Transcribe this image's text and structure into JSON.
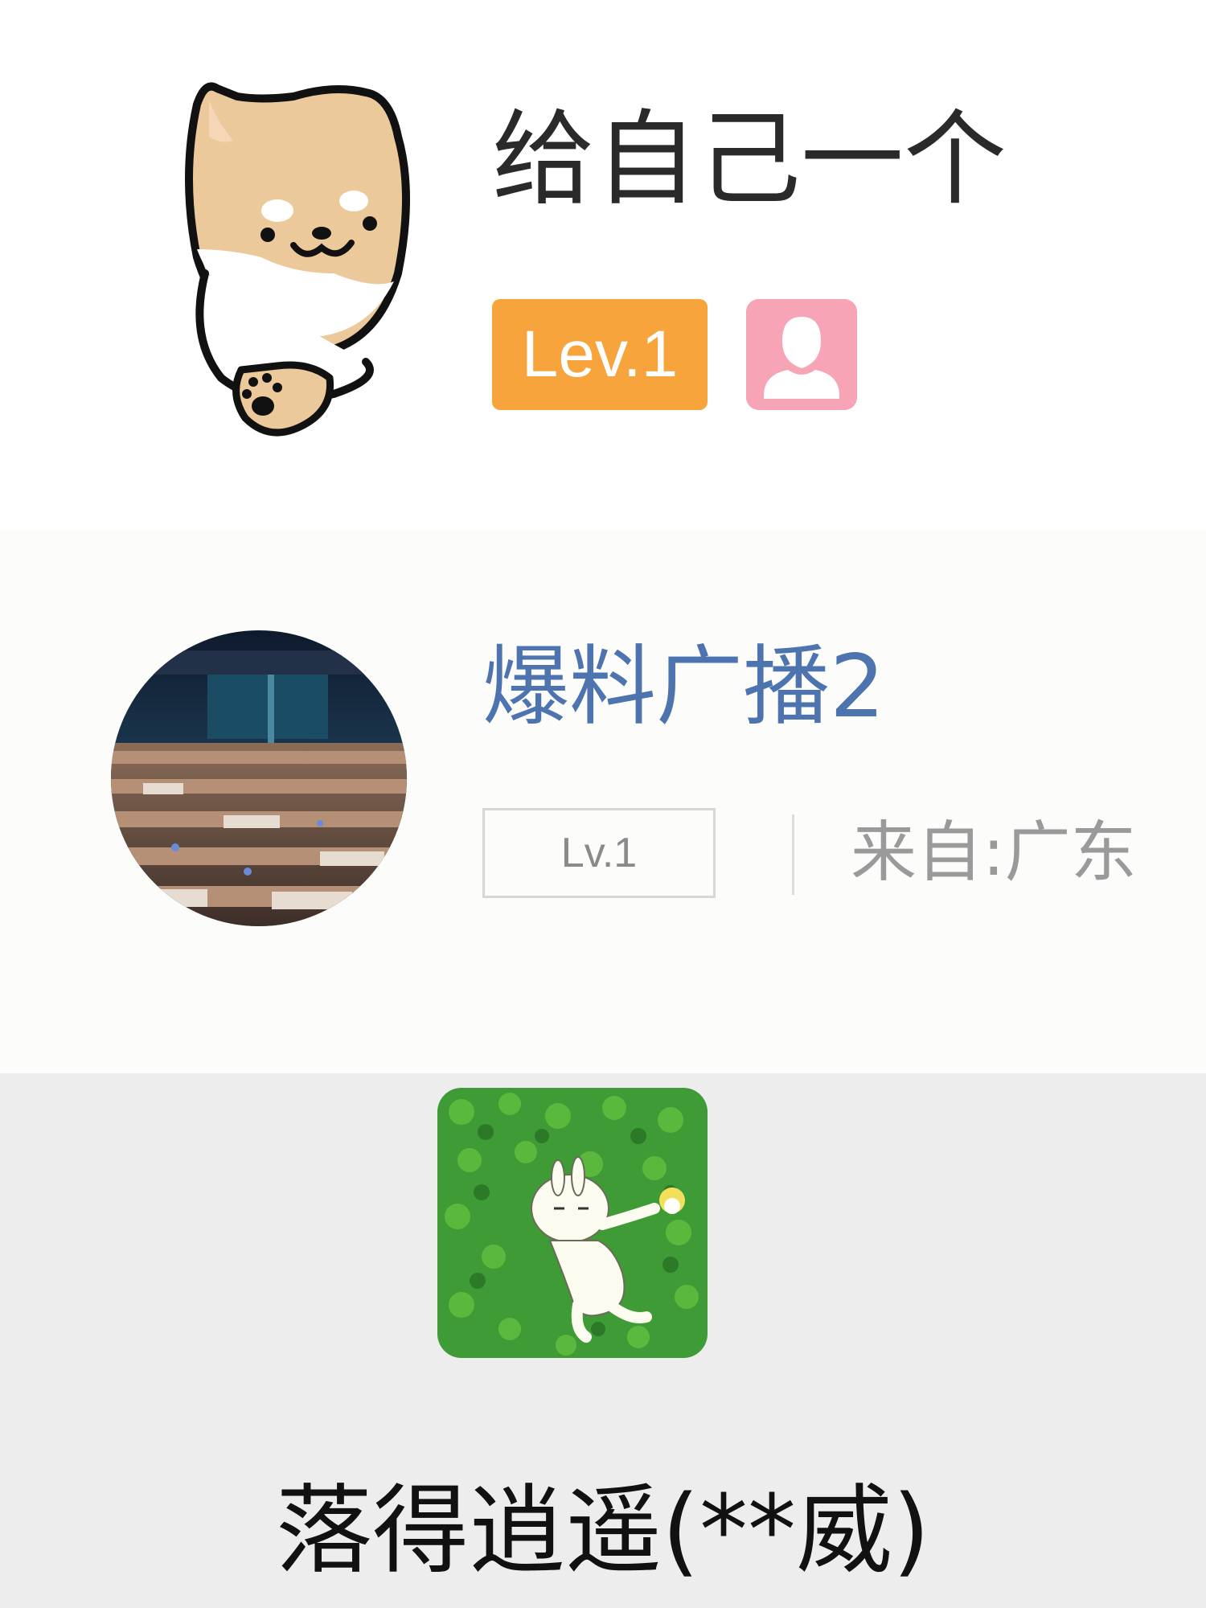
{
  "profile_1": {
    "nickname": "给自己一个",
    "level_badge": "Lev.1",
    "avatar_icon": "shiba-dog-icon",
    "gender_icon": "female-user-icon",
    "colors": {
      "level_badge_bg": "#f7a43c",
      "gender_badge_bg": "#f7a4b6"
    }
  },
  "profile_2": {
    "nickname": "爆料广播2",
    "level_badge": "Lv.1",
    "location": "来自:广东",
    "avatar_icon": "cinema-hall-photo",
    "colors": {
      "nickname": "#4e74b0"
    }
  },
  "profile_3": {
    "nickname": "落得逍遥(**威)",
    "avatar_icon": "rabbit-clover-icon"
  }
}
